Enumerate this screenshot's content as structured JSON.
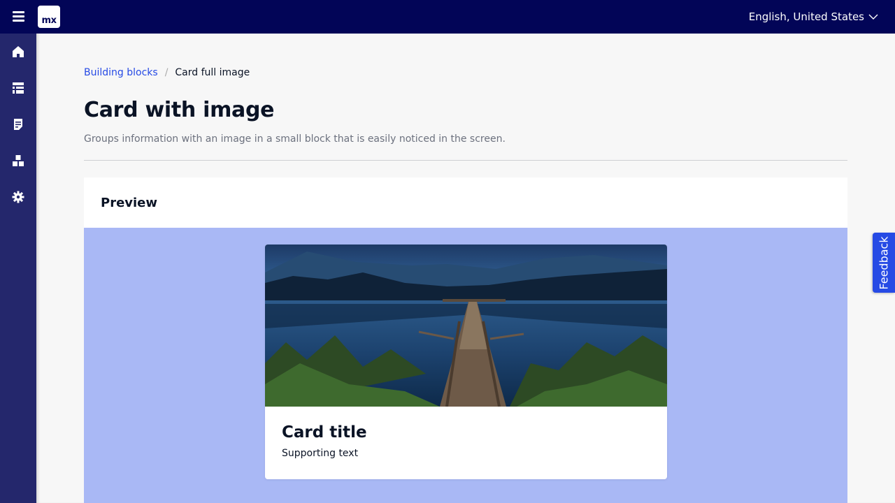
{
  "topbar": {
    "logo_text": "mx",
    "language": "English, United States",
    "menu_icon": "hamburger-icon",
    "dropdown_icon": "chevron-down-icon"
  },
  "sidebar": {
    "items": [
      {
        "icon": "home-icon",
        "label": "Home"
      },
      {
        "icon": "table-icon",
        "label": "Data"
      },
      {
        "icon": "document-icon",
        "label": "Pages"
      },
      {
        "icon": "blocks-icon",
        "label": "Building blocks"
      },
      {
        "icon": "gear-icon",
        "label": "Settings"
      }
    ]
  },
  "breadcrumb": {
    "parent": "Building blocks",
    "separator": "/",
    "current": "Card full image"
  },
  "page": {
    "title": "Card with image",
    "description": "Groups information with an image in a small block that is easily noticed in the screen."
  },
  "preview": {
    "heading": "Preview",
    "card": {
      "title": "Card title",
      "text": "Supporting text"
    }
  },
  "feedback": {
    "label": "Feedback"
  },
  "colors": {
    "topbar": "#020557",
    "sidebar": "#24276c",
    "accent": "#264ae5",
    "preview_bg": "#a9b8f5"
  }
}
